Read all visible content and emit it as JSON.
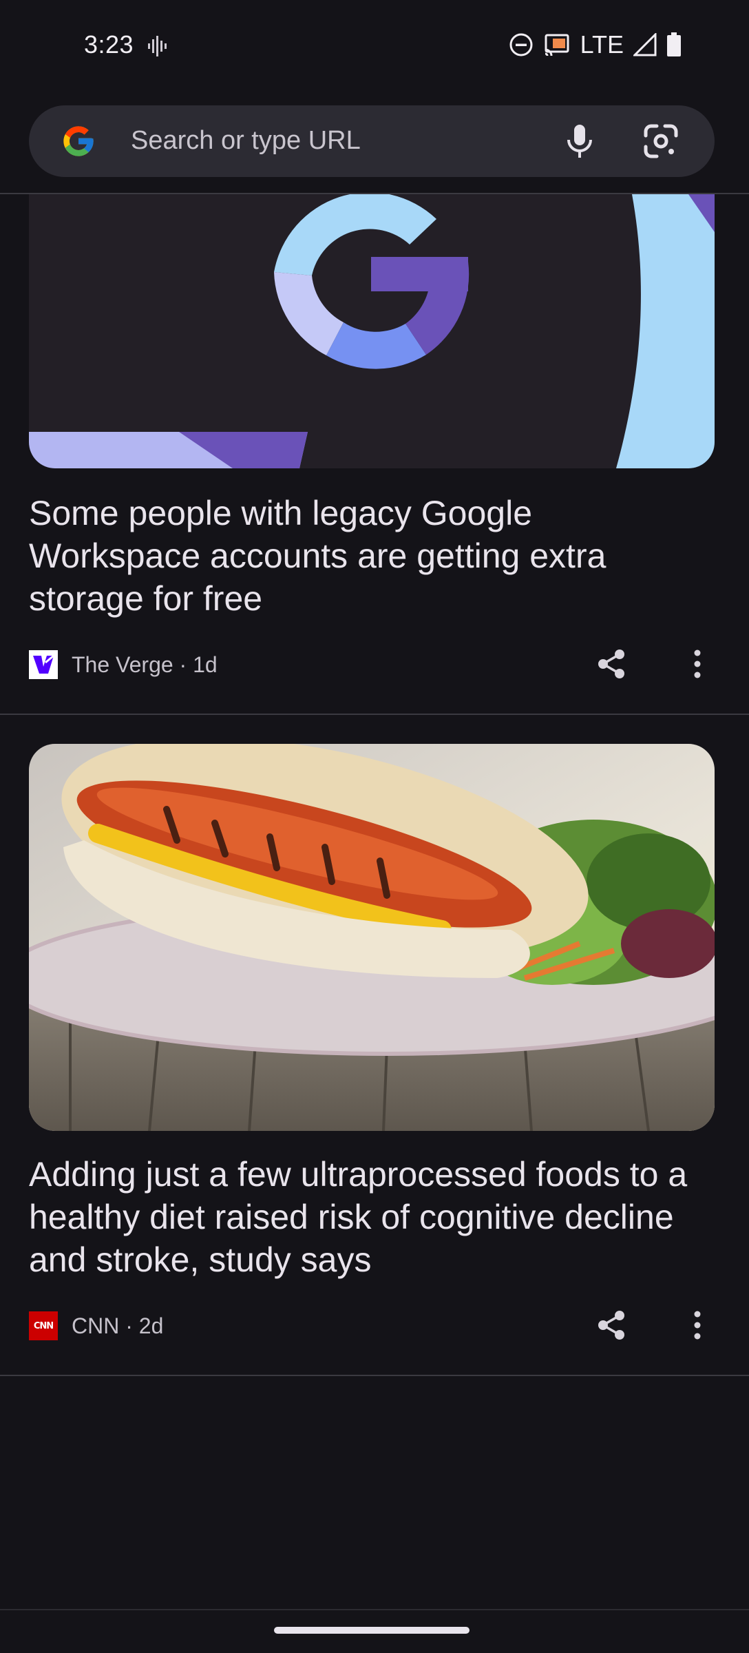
{
  "status_bar": {
    "time": "3:23",
    "network": "LTE"
  },
  "search": {
    "placeholder": "Search or type URL"
  },
  "articles": [
    {
      "title": "Some people with legacy Google Workspace accounts are getting extra storage for free",
      "source": "The Verge · 1d",
      "image": "google-g-logo-illustration"
    },
    {
      "title": "Adding just a few ultraprocessed foods to a healthy diet raised risk of cognitive decline and stroke, study says",
      "source": "CNN · 2d",
      "image": "hot-dog-with-salad-photo"
    }
  ],
  "colors": {
    "background": "#141318",
    "search_bar": "#2c2b33",
    "verge_purple": "#5200ff",
    "cnn_red": "#cc0000"
  }
}
